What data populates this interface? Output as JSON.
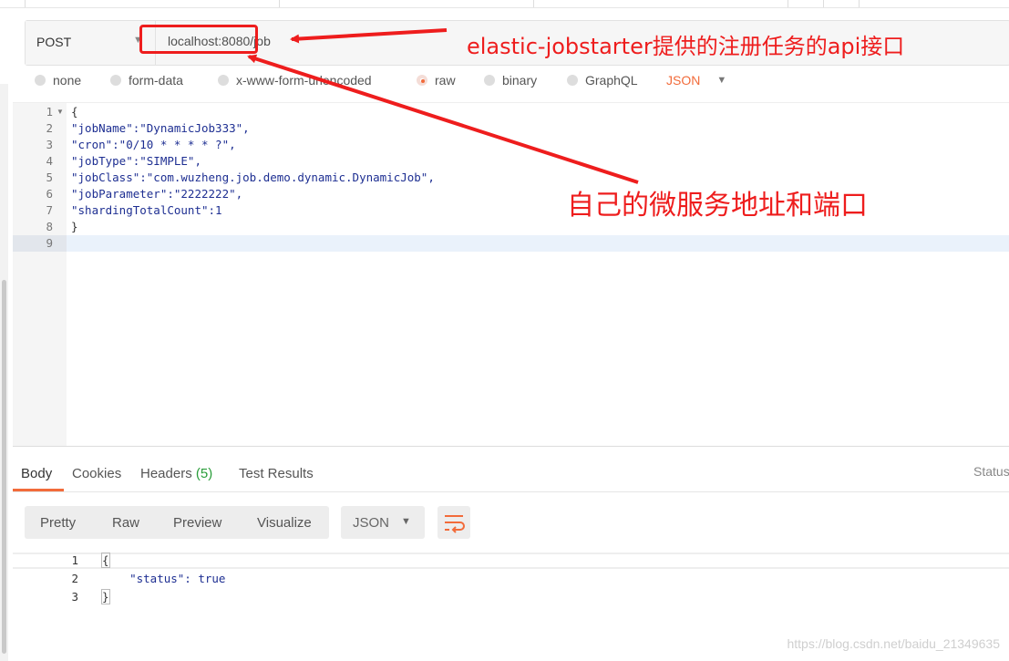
{
  "request": {
    "method": "POST",
    "url": "localhost:8080/job"
  },
  "body_types": {
    "options": [
      "none",
      "form-data",
      "x-www-form-urlencoded",
      "raw",
      "binary",
      "GraphQL"
    ],
    "selected": "raw",
    "format": "JSON"
  },
  "editor": {
    "line_numbers": [
      "1",
      "2",
      "3",
      "4",
      "5",
      "6",
      "7",
      "8",
      "9"
    ],
    "lines": [
      "{",
      "\"jobName\":\"DynamicJob333\",",
      "\"cron\":\"0/10 * * * * ?\",",
      "\"jobType\":\"SIMPLE\",",
      "\"jobClass\":\"com.wuzheng.job.demo.dynamic.DynamicJob\",",
      "\"jobParameter\":\"2222222\",",
      "\"shardingTotalCount\":1",
      "}",
      ""
    ]
  },
  "response": {
    "tabs": [
      "Body",
      "Cookies",
      "Headers",
      "(5)",
      "Test Results"
    ],
    "status_label": "Status",
    "view_modes": [
      "Pretty",
      "Raw",
      "Preview",
      "Visualize"
    ],
    "format": "JSON",
    "line_numbers": [
      "1",
      "2",
      "3"
    ],
    "lines": [
      "{",
      "    \"status\": true",
      "}"
    ]
  },
  "annotations": {
    "api_note": "elastic-jobstarter提供的注册任务的api接口",
    "service_note": "自己的微服务地址和端口",
    "color": "#ee1d1d"
  },
  "watermark": "https://blog.csdn.net/baidu_21349635",
  "colors": {
    "accent": "#f26b3a",
    "code_key": "#1e2f92",
    "headers_count": "#2a9d3a"
  }
}
